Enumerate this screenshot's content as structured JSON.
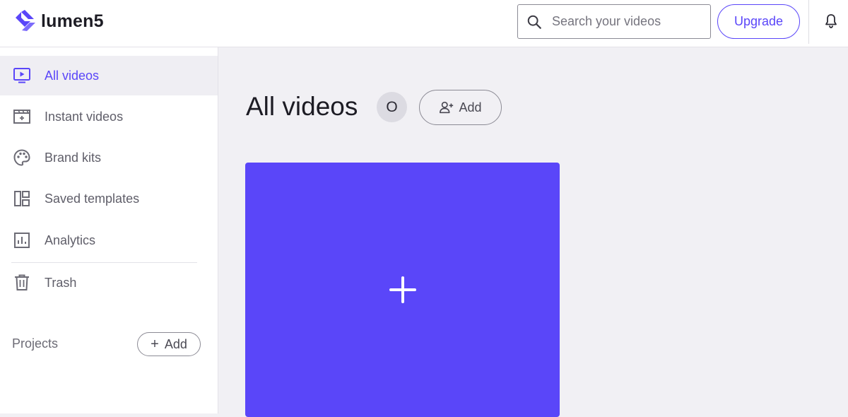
{
  "brand": {
    "name": "lumen5",
    "accent": "#5a46f9"
  },
  "header": {
    "search": {
      "placeholder": "Search your videos",
      "value": ""
    },
    "upgrade_label": "Upgrade"
  },
  "sidebar": {
    "items": [
      {
        "label": "All videos",
        "icon": "play-screen-icon",
        "active": true
      },
      {
        "label": "Instant videos",
        "icon": "clapperboard-icon",
        "active": false
      },
      {
        "label": "Brand kits",
        "icon": "palette-icon",
        "active": false
      },
      {
        "label": "Saved templates",
        "icon": "template-layout-icon",
        "active": false
      },
      {
        "label": "Analytics",
        "icon": "bar-chart-icon",
        "active": false
      },
      {
        "label": "Trash",
        "icon": "trash-icon",
        "active": false
      }
    ],
    "projects_label": "Projects",
    "projects_add_label": "Add"
  },
  "main": {
    "title": "All videos",
    "avatar_initial": "O",
    "add_member_label": "Add",
    "new_video_icon": "plus-icon"
  }
}
